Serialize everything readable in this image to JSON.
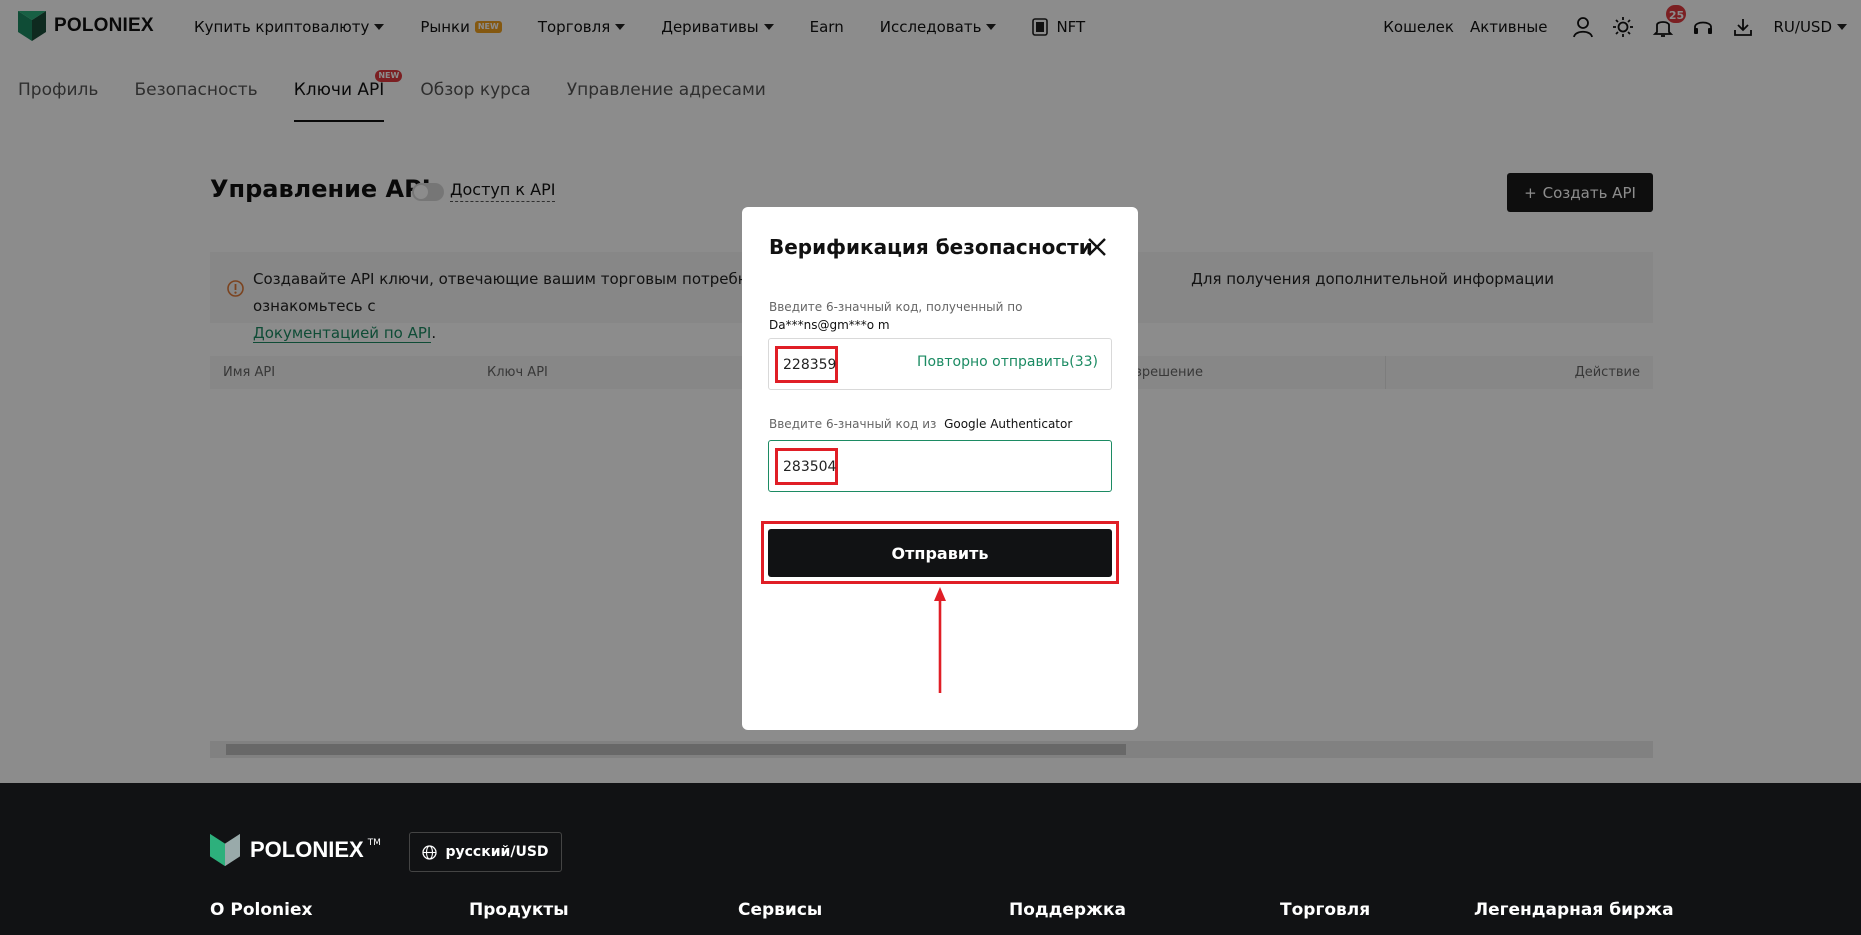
{
  "header": {
    "logo_text": "POLONIEX",
    "nav": [
      {
        "label": "Купить криптовалюту",
        "caret": true
      },
      {
        "label": "Рынки",
        "badge": "NEW"
      },
      {
        "label": "Торговля",
        "caret": true
      },
      {
        "label": "Деривативы",
        "caret": true
      },
      {
        "label": "Earn"
      },
      {
        "label": "Исследовать",
        "caret": true
      },
      {
        "label": "NFT"
      }
    ],
    "wallet": "Кошелек",
    "assets": "Активные",
    "notifications_count": "25",
    "locale": "RU/USD",
    "icons": [
      "user-icon",
      "sun-icon",
      "bell-icon",
      "headset-icon",
      "download-icon"
    ]
  },
  "subtabs": [
    {
      "label": "Профиль"
    },
    {
      "label": "Безопасность"
    },
    {
      "label": "Ключи API",
      "badge": "NEW",
      "active": true
    },
    {
      "label": "Обзор курса"
    },
    {
      "label": "Управление адресами"
    }
  ],
  "main": {
    "title": "Управление API",
    "api_access_label": "Доступ к API",
    "create_button": "Создать API",
    "info_text_start": "Создавайте API ключи, отвечающие вашим торговым потребностям, и не",
    "info_text_end": "Для получения дополнительной информации ознакомьтесь с",
    "info_link": "Документацией по API",
    "info_period": ".",
    "table_headers": {
      "name": "Имя API",
      "key": "Ключ API",
      "permission_partial": "зрешение",
      "action": "Действие"
    }
  },
  "modal": {
    "title": "Верификация безопасности",
    "email_label": "Введите 6-значный код, полученный по",
    "email_value": "Da***ns@gm***o m",
    "email_code": "228359",
    "resend_label": "Повторно отправить(33)",
    "ga_label": "Введите 6-значный код из",
    "ga_value": "Google Authenticator",
    "ga_code": "283504",
    "submit_label": "Отправить"
  },
  "footer": {
    "logo_text": "POLONIEX",
    "tm": "TM",
    "language": "русский/USD",
    "columns": [
      "О Poloniex",
      "Продукты",
      "Сервисы",
      "Поддержка",
      "Торговля",
      "Легендарная биржа"
    ]
  },
  "colors": {
    "accent_green": "#1c8b63",
    "highlight_red": "#e01e26",
    "dark": "#111214"
  }
}
